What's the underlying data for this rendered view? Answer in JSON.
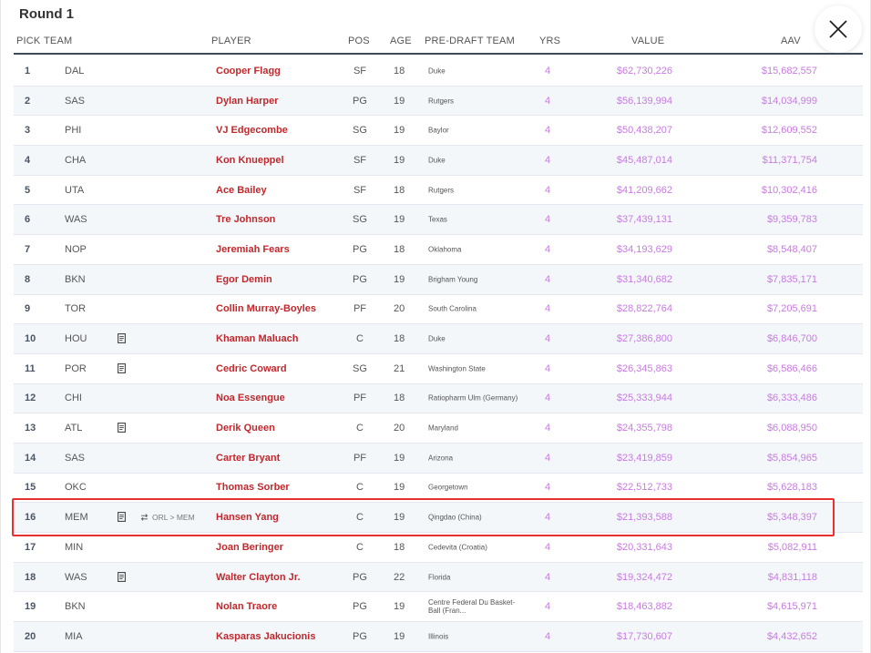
{
  "round_title": "Round 1",
  "columns": {
    "pick": "PICK",
    "team": "TEAM",
    "player": "PLAYER",
    "pos": "POS",
    "age": "AGE",
    "pre_draft_team": "PRE-DRAFT TEAM",
    "yrs": "YRS",
    "value": "VALUE",
    "aav": "AAV"
  },
  "rows": [
    {
      "pick": "1",
      "team": "DAL",
      "note": false,
      "trade": "",
      "player": "Cooper Flagg",
      "pos": "SF",
      "age": "18",
      "school": "Duke",
      "yrs": "4",
      "value": "$62,730,226",
      "aav": "$15,682,557"
    },
    {
      "pick": "2",
      "team": "SAS",
      "note": false,
      "trade": "",
      "player": "Dylan Harper",
      "pos": "PG",
      "age": "19",
      "school": "Rutgers",
      "yrs": "4",
      "value": "$56,139,994",
      "aav": "$14,034,999"
    },
    {
      "pick": "3",
      "team": "PHI",
      "note": false,
      "trade": "",
      "player": "VJ Edgecombe",
      "pos": "SG",
      "age": "19",
      "school": "Baylor",
      "yrs": "4",
      "value": "$50,438,207",
      "aav": "$12,609,552"
    },
    {
      "pick": "4",
      "team": "CHA",
      "note": false,
      "trade": "",
      "player": "Kon Knueppel",
      "pos": "SF",
      "age": "19",
      "school": "Duke",
      "yrs": "4",
      "value": "$45,487,014",
      "aav": "$11,371,754"
    },
    {
      "pick": "5",
      "team": "UTA",
      "note": false,
      "trade": "",
      "player": "Ace Bailey",
      "pos": "SF",
      "age": "18",
      "school": "Rutgers",
      "yrs": "4",
      "value": "$41,209,662",
      "aav": "$10,302,416"
    },
    {
      "pick": "6",
      "team": "WAS",
      "note": false,
      "trade": "",
      "player": "Tre Johnson",
      "pos": "SG",
      "age": "19",
      "school": "Texas",
      "yrs": "4",
      "value": "$37,439,131",
      "aav": "$9,359,783"
    },
    {
      "pick": "7",
      "team": "NOP",
      "note": false,
      "trade": "",
      "player": "Jeremiah Fears",
      "pos": "PG",
      "age": "18",
      "school": "Oklahoma",
      "yrs": "4",
      "value": "$34,193,629",
      "aav": "$8,548,407"
    },
    {
      "pick": "8",
      "team": "BKN",
      "note": false,
      "trade": "",
      "player": "Egor Demin",
      "pos": "PG",
      "age": "19",
      "school": "Brigham Young",
      "yrs": "4",
      "value": "$31,340,682",
      "aav": "$7,835,171"
    },
    {
      "pick": "9",
      "team": "TOR",
      "note": false,
      "trade": "",
      "player": "Collin Murray-Boyles",
      "pos": "PF",
      "age": "20",
      "school": "South Carolina",
      "yrs": "4",
      "value": "$28,822,764",
      "aav": "$7,205,691"
    },
    {
      "pick": "10",
      "team": "HOU",
      "note": true,
      "trade": "",
      "player": "Khaman Maluach",
      "pos": "C",
      "age": "18",
      "school": "Duke",
      "yrs": "4",
      "value": "$27,386,800",
      "aav": "$6,846,700"
    },
    {
      "pick": "11",
      "team": "POR",
      "note": true,
      "trade": "",
      "player": "Cedric Coward",
      "pos": "SG",
      "age": "21",
      "school": "Washington State",
      "yrs": "4",
      "value": "$26,345,863",
      "aav": "$6,586,466"
    },
    {
      "pick": "12",
      "team": "CHI",
      "note": false,
      "trade": "",
      "player": "Noa Essengue",
      "pos": "PF",
      "age": "18",
      "school": "Ratiopharm Ulm (Germany)",
      "yrs": "4",
      "value": "$25,333,944",
      "aav": "$6,333,486"
    },
    {
      "pick": "13",
      "team": "ATL",
      "note": true,
      "trade": "",
      "player": "Derik Queen",
      "pos": "C",
      "age": "20",
      "school": "Maryland",
      "yrs": "4",
      "value": "$24,355,798",
      "aav": "$6,088,950"
    },
    {
      "pick": "14",
      "team": "SAS",
      "note": false,
      "trade": "",
      "player": "Carter Bryant",
      "pos": "PF",
      "age": "19",
      "school": "Arizona",
      "yrs": "4",
      "value": "$23,419,859",
      "aav": "$5,854,965"
    },
    {
      "pick": "15",
      "team": "OKC",
      "note": false,
      "trade": "",
      "player": "Thomas Sorber",
      "pos": "C",
      "age": "19",
      "school": "Georgetown",
      "yrs": "4",
      "value": "$22,512,733",
      "aav": "$5,628,183"
    },
    {
      "pick": "16",
      "team": "MEM",
      "note": true,
      "trade": "ORL > MEM",
      "player": "Hansen Yang",
      "pos": "C",
      "age": "19",
      "school": "Qingdao (China)",
      "yrs": "4",
      "value": "$21,393,588",
      "aav": "$5,348,397"
    },
    {
      "pick": "17",
      "team": "MIN",
      "note": false,
      "trade": "",
      "player": "Joan Beringer",
      "pos": "C",
      "age": "18",
      "school": "Cedevita (Croatia)",
      "yrs": "4",
      "value": "$20,331,643",
      "aav": "$5,082,911"
    },
    {
      "pick": "18",
      "team": "WAS",
      "note": true,
      "trade": "",
      "player": "Walter Clayton Jr.",
      "pos": "PG",
      "age": "22",
      "school": "Florida",
      "yrs": "4",
      "value": "$19,324,472",
      "aav": "$4,831,118"
    },
    {
      "pick": "19",
      "team": "BKN",
      "note": false,
      "trade": "",
      "player": "Nolan Traore",
      "pos": "PG",
      "age": "19",
      "school": "Centre Federal Du Basket-Ball (Fran...",
      "yrs": "4",
      "value": "$18,463,882",
      "aav": "$4,615,971"
    },
    {
      "pick": "20",
      "team": "MIA",
      "note": false,
      "trade": "",
      "player": "Kasparas Jakucionis",
      "pos": "PG",
      "age": "19",
      "school": "Illinois",
      "yrs": "4",
      "value": "$17,730,607",
      "aav": "$4,432,652"
    }
  ],
  "highlighted_pick": "16",
  "colors": {
    "player_name": "#c0282d",
    "money": "#c77be0",
    "highlight_border": "#e8302e",
    "header_rule": "#3c4a5c"
  },
  "icons": {
    "close": "close-icon",
    "note": "note-icon",
    "trade": "swap-icon"
  }
}
